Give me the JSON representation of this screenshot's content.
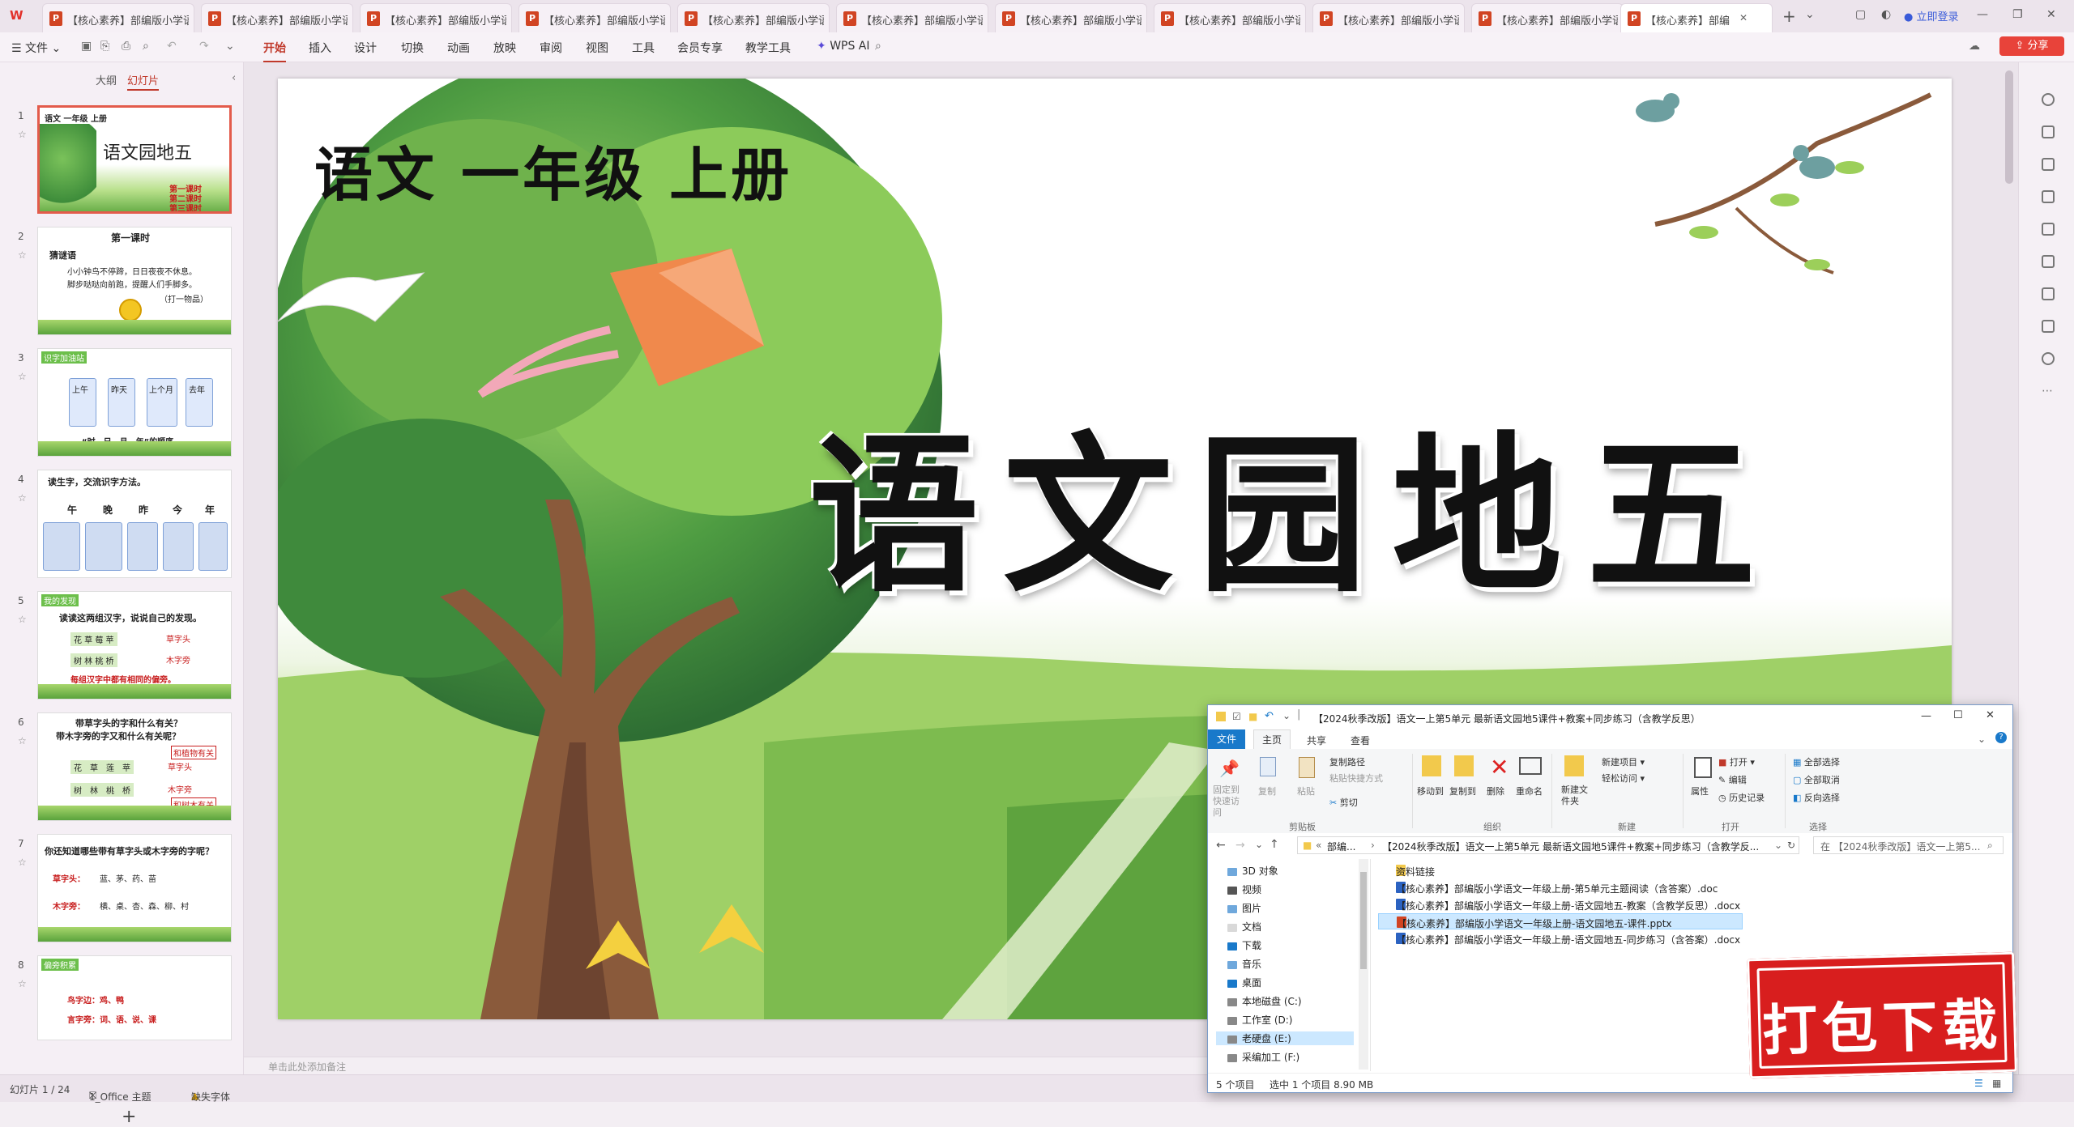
{
  "tabs": {
    "logo": "W",
    "items": [
      {
        "label": "【核心素养】部编版小学语"
      },
      {
        "label": "【核心素养】部编版小学语"
      },
      {
        "label": "【核心素养】部编版小学语"
      },
      {
        "label": "【核心素养】部编版小学语"
      },
      {
        "label": "【核心素养】部编版小学语"
      },
      {
        "label": "【核心素养】部编版小学语"
      },
      {
        "label": "【核心素养】部编版小学语"
      },
      {
        "label": "【核心素养】部编版小学语"
      },
      {
        "label": "【核心素养】部编版小学语"
      },
      {
        "label": "【核心素养】部编版小学语"
      },
      {
        "label": "【核心素养】部编"
      }
    ],
    "login": "立即登录"
  },
  "menu": {
    "file": "文件",
    "items": [
      "开始",
      "插入",
      "设计",
      "切换",
      "动画",
      "放映",
      "审阅",
      "视图",
      "工具",
      "会员专享",
      "教学工具"
    ],
    "active": "开始",
    "wps_ai": "WPS AI",
    "share": "分享"
  },
  "panel": {
    "tab_outline": "大纲",
    "tab_slides": "幻灯片",
    "add": "+",
    "slides": [
      {
        "num": "1",
        "lines": [
          "语文 一年级 上册",
          "语文园地五",
          "第一课时",
          "第二课时",
          "第三课时"
        ]
      },
      {
        "num": "2",
        "lines": [
          "第一课时",
          "猜谜语",
          "小小钟鸟不停蹄，日日夜夜不休息。",
          "脚步哒哒向前跑，提醒人们手脚多。",
          "（打一物品）"
        ]
      },
      {
        "num": "3",
        "lines": [
          "识字加油站",
          "上午",
          "昨天",
          "上个月",
          "去年",
          "“时—日—月—年”的顺序"
        ]
      },
      {
        "num": "4",
        "lines": [
          "读生字，交流识字方法。",
          "午",
          "晚",
          "昨",
          "今",
          "年"
        ]
      },
      {
        "num": "5",
        "lines": [
          "我的发现",
          "读读这两组汉字，说说自己的发现。",
          "花 草 莓 苹",
          "草字头",
          "树 林 桃 桥",
          "木字旁",
          "每组汉字中都有相同的偏旁。"
        ]
      },
      {
        "num": "6",
        "lines": [
          "带草字头的字和什么有关？",
          "带木字旁的字又和什么有关呢？",
          "和植物有关",
          "草字头",
          "木字旁",
          "和树木有关"
        ]
      },
      {
        "num": "7",
        "lines": [
          "你还知道哪些带有草字头或木字旁的字呢？",
          "草字头：",
          "蓝、茅、药、苗",
          "木字旁：",
          "横、桌、杏、森、柳、村"
        ]
      },
      {
        "num": "8",
        "lines": [
          "偏旁积累",
          "鸟字边：鸡、鸭",
          "言字旁：词、语、说、课"
        ]
      }
    ]
  },
  "slide": {
    "subtitle": "语文  一年级  上册",
    "title": "语文园地五"
  },
  "notes": {
    "placeholder": "单击此处添加备注"
  },
  "status": {
    "slide_count": "幻灯片 1 / 24",
    "theme": "1_Office 主题",
    "font_missing": "缺失字体"
  },
  "explorer": {
    "title": "【2024秋季改版】语文一上第5单元 最新语文园地5课件+教案+同步练习（含教学反思）",
    "tabs": [
      "文件",
      "主页",
      "共享",
      "查看"
    ],
    "ribbon": {
      "pin": "固定到快速访问",
      "copy": "复制",
      "paste": "粘贴",
      "copy_path": "复制路径",
      "paste_shortcut": "粘贴快捷方式",
      "cut": "剪切",
      "group_clipboard": "剪贴板",
      "move_to": "移动到",
      "copy_to": "复制到",
      "delete": "删除",
      "rename": "重命名",
      "group_organize": "组织",
      "new_folder": "新建文件夹",
      "new_item": "新建项目",
      "easy_access": "轻松访问",
      "group_new": "新建",
      "properties": "属性",
      "open": "打开",
      "edit": "编辑",
      "history": "历史记录",
      "group_open": "打开",
      "select_all": "全部选择",
      "select_none": "全部取消",
      "invert": "反向选择",
      "group_select": "选择"
    },
    "address": [
      "部编...",
      "【2024秋季改版】语文一上第5单元 最新语文园地5课件+教案+同步练习（含教学反..."
    ],
    "search": "在 【2024秋季改版】语文一上第5...",
    "nav": [
      "3D 对象",
      "视频",
      "图片",
      "文档",
      "下载",
      "音乐",
      "桌面",
      "本地磁盘 (C:)",
      "工作室 (D:)",
      "老硬盘 (E:)",
      "采编加工 (F:)"
    ],
    "files": [
      {
        "name": "资料链接",
        "type": "folder"
      },
      {
        "name": "【核心素养】部编版小学语文一年级上册-第5单元主题阅读（含答案）.doc",
        "type": "doc"
      },
      {
        "name": "【核心素养】部编版小学语文一年级上册-语文园地五-教案（含教学反思）.docx",
        "type": "doc"
      },
      {
        "name": "【核心素养】部编版小学语文一年级上册-语文园地五-课件.pptx",
        "type": "ppt"
      },
      {
        "name": "【核心素养】部编版小学语文一年级上册-语文园地五-同步练习（含答案）.docx",
        "type": "doc"
      }
    ],
    "status_items": "5 个项目",
    "status_selected": "选中 1 个项目  8.90 MB"
  },
  "stamp": "打包下载"
}
